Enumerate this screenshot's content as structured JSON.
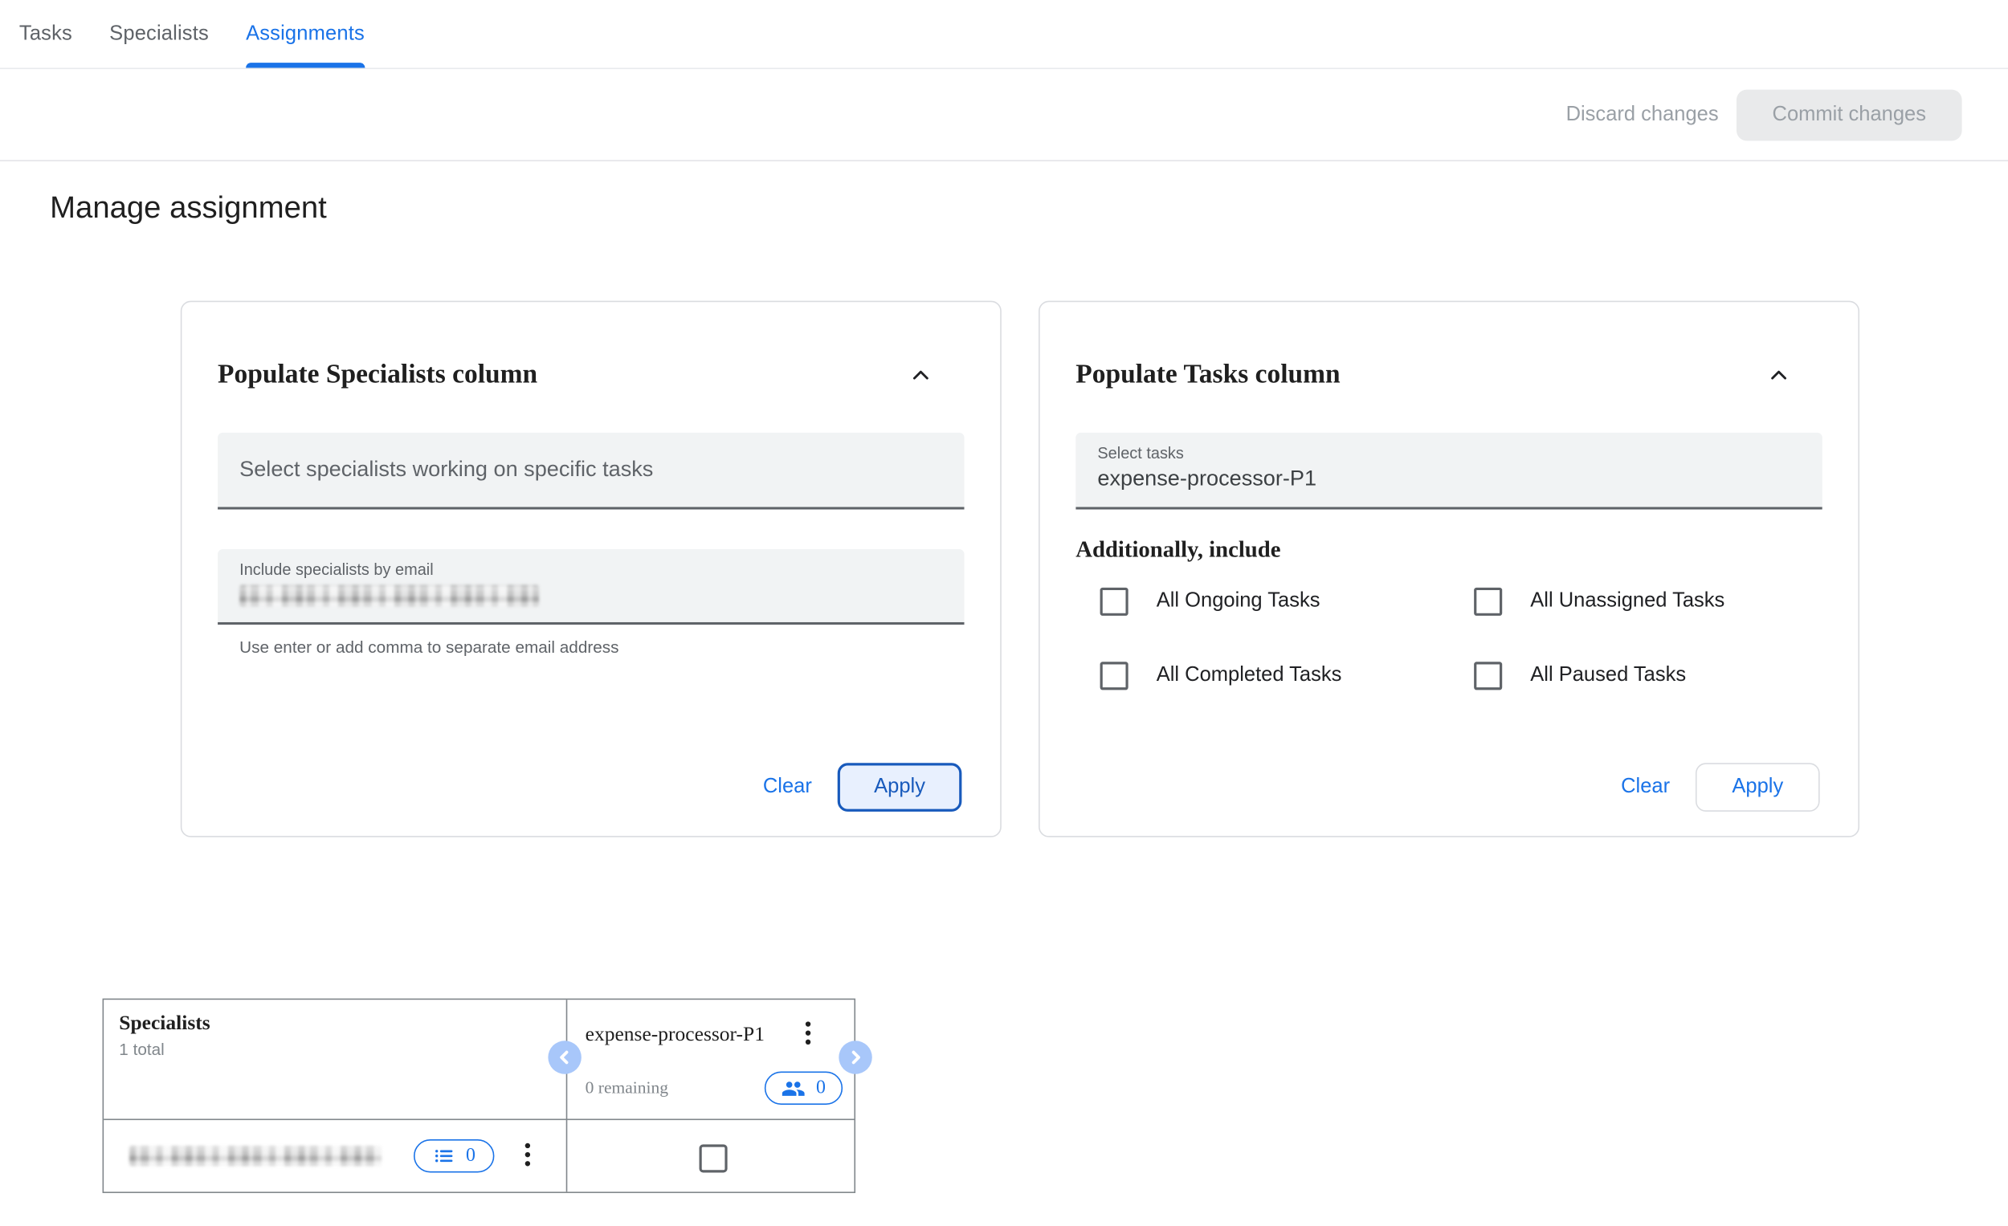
{
  "tabs": {
    "items": [
      {
        "label": "Tasks",
        "active": false
      },
      {
        "label": "Specialists",
        "active": false
      },
      {
        "label": "Assignments",
        "active": true
      }
    ]
  },
  "actionbar": {
    "discard_label": "Discard changes",
    "commit_label": "Commit changes",
    "state": "disabled"
  },
  "page": {
    "title": "Manage assignment"
  },
  "specialists_card": {
    "title": "Populate Specialists column",
    "collapse_icon": "chevron-up-icon",
    "select_placeholder": "Select specialists working on specific tasks",
    "email_field_label": "Include specialists by email",
    "email_field_value_redacted": true,
    "helper_text": "Use enter or add comma to separate email address",
    "clear_label": "Clear",
    "apply_label": "Apply"
  },
  "tasks_card": {
    "title": "Populate Tasks column",
    "collapse_icon": "chevron-up-icon",
    "select_label": "Select tasks",
    "select_value": "expense-processor-P1",
    "additionally_label": "Additionally, include",
    "checkboxes": [
      {
        "label": "All Ongoing Tasks",
        "checked": false
      },
      {
        "label": "All Unassigned Tasks",
        "checked": false
      },
      {
        "label": "All Completed Tasks",
        "checked": false
      },
      {
        "label": "All Paused Tasks",
        "checked": false
      }
    ],
    "clear_label": "Clear",
    "apply_label": "Apply"
  },
  "assignment_table": {
    "specialists_header": "Specialists",
    "specialists_total": "1 total",
    "task_columns": [
      {
        "name": "expense-processor-P1",
        "remaining": "0 remaining",
        "assigned_count": "0"
      }
    ],
    "rows": [
      {
        "email_redacted": true,
        "tasks_count": "0",
        "assigned_checkbox_checked": false
      }
    ]
  },
  "icons": {
    "collapse": "chevron-up-icon",
    "column_menu": "more-vert-icon",
    "assigned_people": "people-icon",
    "specialist_tasks": "list-icon",
    "nav_prev": "chevron-left-icon",
    "nav_next": "chevron-right-icon"
  },
  "colors": {
    "accent": "#1a73e8",
    "apply_focus_border": "#185abc",
    "disabled_text": "#9aa0a6",
    "table_border": "#80868b",
    "field_fill": "#f1f3f4"
  }
}
